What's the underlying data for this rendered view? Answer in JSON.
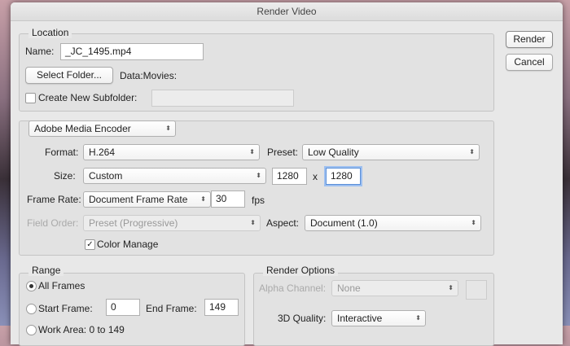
{
  "window": {
    "title": "Render Video"
  },
  "buttons": {
    "render": "Render",
    "cancel": "Cancel"
  },
  "location": {
    "legend": "Location",
    "name_label": "Name:",
    "name_value": "_JC_1495.mp4",
    "select_folder": "Select Folder...",
    "folder_path": "Data:Movies:",
    "create_subfolder": "Create New Subfolder:",
    "subfolder_value": ""
  },
  "encoder": {
    "selected": "Adobe Media Encoder",
    "format_label": "Format:",
    "format": "H.264",
    "preset_label": "Preset:",
    "preset": "Low Quality",
    "size_label": "Size:",
    "size": "Custom",
    "width": "1280",
    "x": "x",
    "height": "1280",
    "frame_rate_label": "Frame Rate:",
    "frame_rate": "Document Frame Rate",
    "fps_value": "30",
    "fps": "fps",
    "field_order_label": "Field Order:",
    "field_order": "Preset (Progressive)",
    "aspect_label": "Aspect:",
    "aspect": "Document (1.0)",
    "color_manage": "Color Manage",
    "arrow": "⬍"
  },
  "range": {
    "legend": "Range",
    "all_frames": "All Frames",
    "start_frame_label": "Start Frame:",
    "start_frame": "0",
    "end_frame_label": "End Frame:",
    "end_frame": "149",
    "work_area": "Work Area: 0 to 149"
  },
  "render_options": {
    "legend": "Render Options",
    "alpha_label": "Alpha Channel:",
    "alpha": "None",
    "quality_label": "3D Quality:",
    "quality": "Interactive"
  }
}
